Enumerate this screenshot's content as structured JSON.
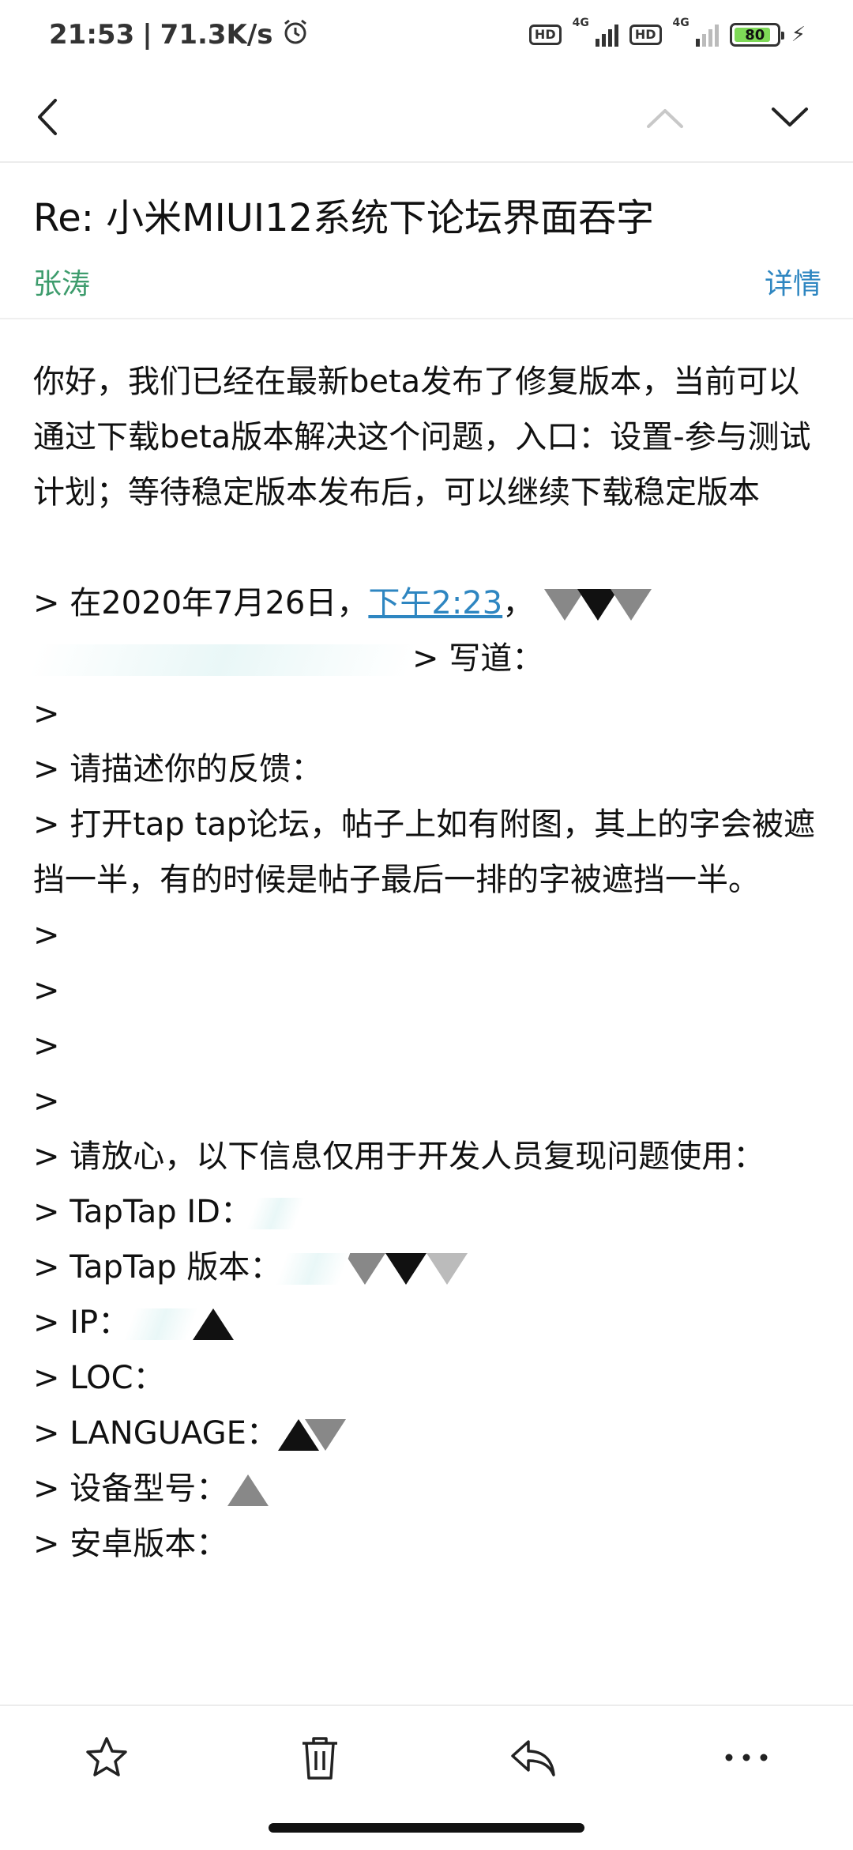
{
  "status_bar": {
    "time": "21:53",
    "speed": "71.3K/s",
    "sim1": {
      "badge": "HD",
      "network": "4G"
    },
    "sim2": {
      "badge": "HD",
      "network": "4G"
    },
    "battery": "80"
  },
  "nav": {
    "back_icon": "chevron-left-icon",
    "prev_icon": "chevron-up-icon",
    "next_icon": "chevron-down-icon"
  },
  "email": {
    "subject": "Re: 小米MIUI12系统下论坛界面吞字",
    "sender": "张涛",
    "details_label": "详情",
    "reply_text": "你好，我们已经在最新beta发布了修复版本，当前可以通过下载beta版本解决这个问题，入口：设置-参与测试计划；等待稳定版本发布后，可以继续下载稳定版本",
    "quote_intro_prefix": "> 在2020年7月26日，",
    "quote_time_link": "下午2:23",
    "quote_intro_comma": "，",
    "quote_wrote": "> 写道：",
    "quoted": {
      "gt": ">",
      "feedback_label": "> 请描述你的反馈：",
      "feedback_text": "> 打开tap tap论坛，帖子上如有附图，其上的字会被遮挡一半，有的时候是帖子最后一排的字被遮挡一半。",
      "reassure": "> 请放心，以下信息仅用于开发人员复现问题使用：",
      "taptap_id": "> TapTap ID：",
      "taptap_version": "> TapTap 版本：",
      "ip": "> IP：",
      "loc": "> LOC：",
      "language": "> LANGUAGE：",
      "device_model": "> 设备型号：",
      "android_version": "> 安卓版本："
    }
  },
  "toolbar": {
    "star_icon": "star-icon",
    "delete_icon": "trash-icon",
    "reply_icon": "reply-icon",
    "more_icon": "more-icon"
  },
  "colors": {
    "sender": "#3e9c6d",
    "link": "#2e86c1",
    "battery_fill": "#7ed957"
  }
}
